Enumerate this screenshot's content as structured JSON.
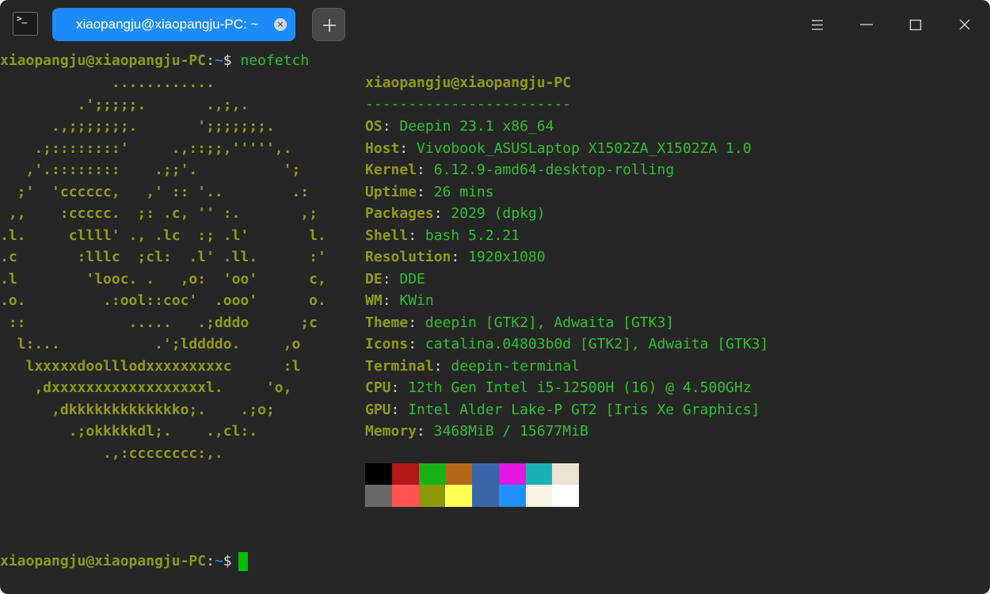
{
  "window": {
    "tab_title": "xiaopangju@xiaopangju-PC: ~",
    "tab_close_glyph": "×",
    "app_icon_glyph": ">_"
  },
  "colors": {
    "tab_active": "#1d8cf8",
    "user_color": "#8a9a14",
    "value_color": "#2fbf2f",
    "path_color": "#1d8cf8",
    "cursor": "#00c000"
  },
  "terminal": {
    "prompt1": {
      "user": "xiaopangju@xiaopangju-PC",
      "sep": ":",
      "path": "~",
      "dollar": "$ ",
      "command": "neofetch"
    },
    "prompt2": {
      "user": "xiaopangju@xiaopangju-PC",
      "sep": ":",
      "path": "~",
      "dollar": "$"
    },
    "logo": [
      "             ............",
      "         .';;;;;.       .,;,.",
      "      .,;;;;;;;.       ';;;;;;;.",
      "    .;::::::::'     .,::;;,''''',.",
      "   ,'.::::::::    .;;'.          ';",
      "  ;'  'cccccc,   ,' :: '..        .:",
      " ,,    :ccccc.  ;: .c, '' :.       ,;",
      ".l.     cllll' ., .lc  :; .l'       l.",
      ".c       :lllc  ;cl:  .l' .ll.      :'",
      ".l        'looc. .   ,o:  'oo'      c,",
      ".o.         .:ool::coc'  .ooo'      o.",
      " ::            .....   .;dddo      ;c",
      "  l:...           .';lddddo.     ,o",
      "   lxxxxxdoolllodxxxxxxxxxc      :l",
      "    ,dxxxxxxxxxxxxxxxxxxl.     'o,",
      "      ,dkkkkkkkkkkkkko;.    .;o;",
      "        .;okkkkkdl;.    .,cl:.",
      "            .,:cccccccc:,."
    ],
    "header": "xiaopangju@xiaopangju-PC",
    "underline": "------------------------",
    "info": [
      {
        "key": "OS",
        "value": "Deepin 23.1 x86_64"
      },
      {
        "key": "Host",
        "value": "Vivobook_ASUSLaptop X1502ZA_X1502ZA 1.0"
      },
      {
        "key": "Kernel",
        "value": "6.12.9-amd64-desktop-rolling"
      },
      {
        "key": "Uptime",
        "value": "26 mins"
      },
      {
        "key": "Packages",
        "value": "2029 (dpkg)"
      },
      {
        "key": "Shell",
        "value": "bash 5.2.21"
      },
      {
        "key": "Resolution",
        "value": "1920x1080"
      },
      {
        "key": "DE",
        "value": "DDE"
      },
      {
        "key": "WM",
        "value": "KWin"
      },
      {
        "key": "Theme",
        "value": "deepin [GTK2], Adwaita [GTK3]"
      },
      {
        "key": "Icons",
        "value": "catalina.04803b0d [GTK2], Adwaita [GTK3]"
      },
      {
        "key": "Terminal",
        "value": "deepin-terminal"
      },
      {
        "key": "CPU",
        "value": "12th Gen Intel i5-12500H (16) @ 4.500GHz"
      },
      {
        "key": "GPU",
        "value": "Intel Alder Lake-P GT2 [Iris Xe Graphics]"
      },
      {
        "key": "Memory",
        "value": "3468MiB / 15677MiB"
      }
    ],
    "info_sep": ": ",
    "palette_top": [
      "#000000",
      "#b21818",
      "#18b218",
      "#b26818",
      "#3b64a8",
      "#e018e0",
      "#18b2b2",
      "#ece4d0"
    ],
    "palette_bottom": [
      "#686868",
      "#ff5454",
      "#8a9a08",
      "#ffff54",
      "#3b64a8",
      "#1e90ff",
      "#fcf4e0",
      "#ffffff"
    ]
  }
}
